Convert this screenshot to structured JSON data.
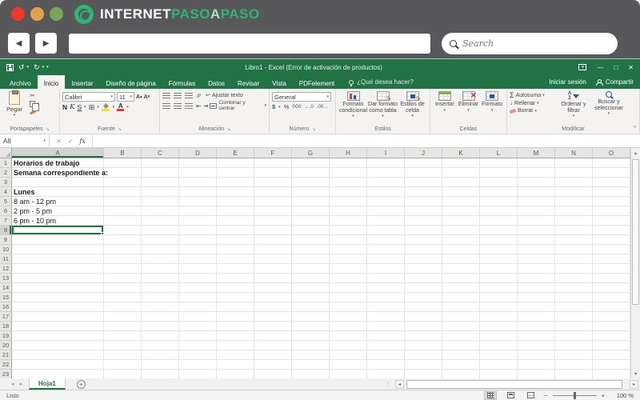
{
  "frame": {
    "brand": {
      "part1": "INTERNET",
      "part2": "PASO",
      "part3": "A",
      "part4": "PASO"
    },
    "search_placeholder": "Search"
  },
  "titlebar": {
    "title": "Libro1 - Excel (Error de activación de productos)"
  },
  "tab_bar": {
    "tabs": [
      {
        "label": "Archivo",
        "active": false
      },
      {
        "label": "Inicio",
        "active": true
      },
      {
        "label": "Insertar",
        "active": false
      },
      {
        "label": "Diseño de página",
        "active": false
      },
      {
        "label": "Fórmulas",
        "active": false
      },
      {
        "label": "Datos",
        "active": false
      },
      {
        "label": "Revisar",
        "active": false
      },
      {
        "label": "Vista",
        "active": false
      },
      {
        "label": "PDFelement",
        "active": false
      }
    ],
    "help_text": "¿Qué desea hacer?",
    "sign_in": "Iniciar sesión",
    "share": "Compartir"
  },
  "ribbon": {
    "portapapeles": {
      "label": "Portapapeles",
      "paste": "Pegar"
    },
    "fuente": {
      "label": "Fuente",
      "font_name": "Calibri",
      "font_size": "11",
      "bold": "N",
      "italic": "K",
      "underline": "S"
    },
    "alineacion": {
      "label": "Alineación",
      "wrap_text": "Ajustar texto",
      "merge_center": "Combinar y centrar"
    },
    "numero": {
      "label": "Número",
      "format": "General",
      "currency": "$",
      "percent": "%",
      "thousands": "000",
      "dec_inc": "←.0",
      "dec_dec": ".00→"
    },
    "estilos": {
      "label": "Estilos",
      "conditional": "Formato condicional",
      "format_table": "Dar formato como tabla",
      "cell_styles": "Estilos de celda"
    },
    "celdas": {
      "label": "Celdas",
      "insert": "Insertar",
      "delete": "Eliminar",
      "format": "Formato"
    },
    "modificar": {
      "label": "Modificar",
      "autosum": "Autosuma",
      "fill": "Rellenar",
      "clear": "Borrar",
      "sort": "Ordenar y filtrar",
      "find": "Buscar y seleccionar"
    }
  },
  "formula_bar": {
    "name_box": "A8",
    "function_label": "fx",
    "value": ""
  },
  "grid": {
    "columns": [
      "A",
      "B",
      "C",
      "D",
      "E",
      "F",
      "G",
      "H",
      "I",
      "J",
      "K",
      "L",
      "M",
      "N",
      "O"
    ],
    "row_count": 23,
    "selected_column": "A",
    "selected_row": 8,
    "selected_cell": "A8",
    "cells": [
      {
        "ref": "A1",
        "text": "Horarios de trabajo",
        "bold": true
      },
      {
        "ref": "A2",
        "text": "Semana correspondiente a:",
        "bold": true
      },
      {
        "ref": "A4",
        "text": "Lunes",
        "bold": true
      },
      {
        "ref": "A5",
        "text": "8 am - 12 pm",
        "bold": false
      },
      {
        "ref": "A6",
        "text": "2 pm - 5 pm",
        "bold": false
      },
      {
        "ref": "A7",
        "text": "6 pm - 10 pm",
        "bold": false
      }
    ]
  },
  "sheet_bar": {
    "sheet_name": "Hoja1",
    "add_label": "+"
  },
  "status_bar": {
    "status": "Listo",
    "zoom_level": "100 %"
  },
  "icons": {
    "back": "◀",
    "forward": "▶",
    "undo": "↺",
    "redo": "↻",
    "dropdown": "▾",
    "minimize": "—",
    "maximize": "□",
    "close": "✕",
    "scissors": "✂",
    "borders": "⊞",
    "sigma": "Σ",
    "fill_arrow": "↓",
    "check": "✓",
    "cancel": "✕",
    "up": "▴",
    "down": "▾",
    "left": "◂",
    "right": "▸",
    "launcher": "↘",
    "collapse": "^",
    "letter_a": "A",
    "orientation": "ab",
    "wrap": "↩",
    "indent_out": "⇤",
    "indent_in": "⇥",
    "dots": "⋮",
    "minus": "−",
    "plus": "+",
    "pencil": "✎"
  }
}
